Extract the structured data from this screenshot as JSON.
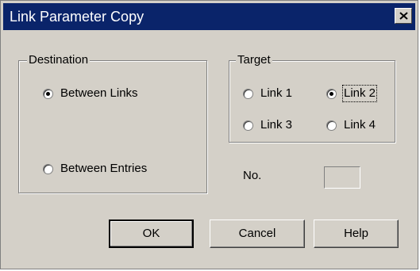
{
  "window": {
    "title": "Link Parameter Copy"
  },
  "destination": {
    "legend": "Destination",
    "options": [
      {
        "label": "Between Links",
        "selected": true
      },
      {
        "label": "Between Entries",
        "selected": false
      }
    ]
  },
  "target": {
    "legend": "Target",
    "options": [
      {
        "label": "Link 1",
        "selected": false
      },
      {
        "label": "Link 2",
        "selected": true
      },
      {
        "label": "Link 3",
        "selected": false
      },
      {
        "label": "Link 4",
        "selected": false
      }
    ]
  },
  "number": {
    "label": "No.",
    "value": ""
  },
  "buttons": {
    "ok": "OK",
    "cancel": "Cancel",
    "help": "Help"
  },
  "icons": {
    "close": "close-icon"
  },
  "colors": {
    "titlebar": "#0a246a",
    "dialog_face": "#d4d0c8"
  }
}
